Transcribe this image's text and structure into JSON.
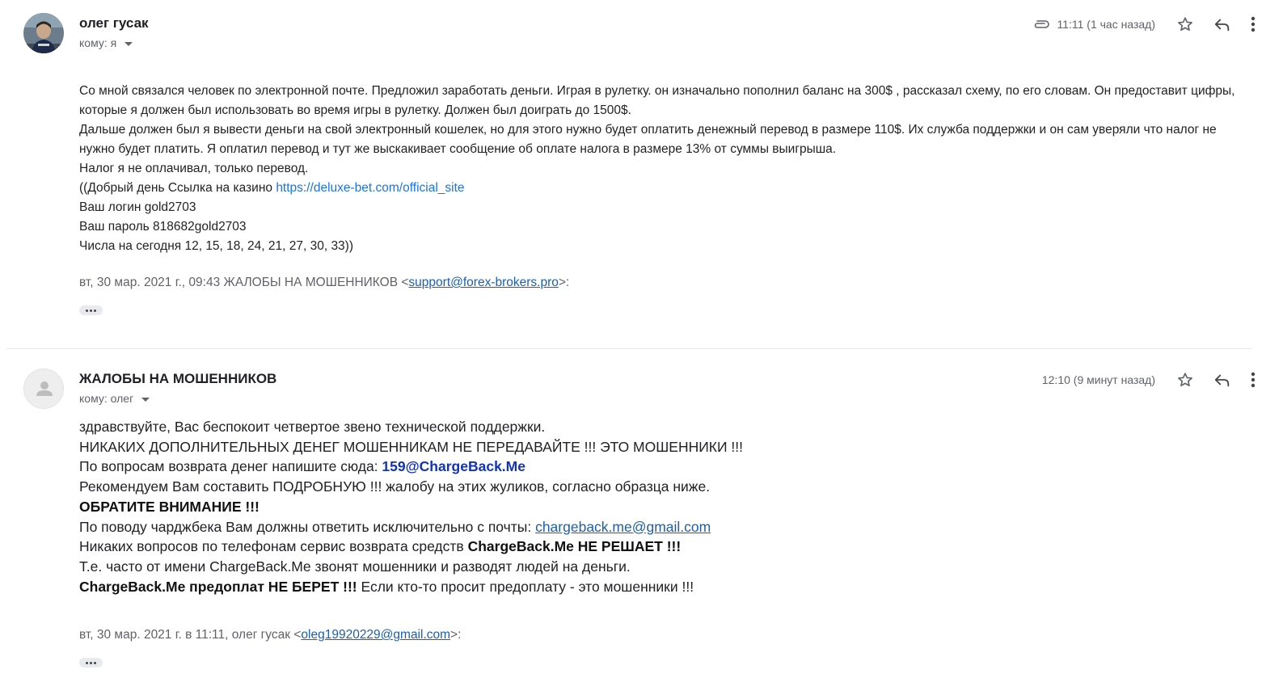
{
  "colors": {
    "link": "#1a73e8",
    "muted": "#5f6368",
    "chargeback_blue": "#1133bb"
  },
  "message1": {
    "sender": "олег гусак",
    "recipient_label": "кому: я",
    "has_attachment": true,
    "time": "11:11 (1 час назад)",
    "body": {
      "line1": "Со мной связался человек по электронной почте. Предложил заработать деньги. Играя в рулетку. он изначально пополнил баланс на 300$ , рассказал схему, по его словам. Он предоставит цифры, которые я должен был использовать во время игры в рулетку. Должен был доиграть до 1500$.",
      "line2": "Дальше должен был я вывести деньги на свой электронный кошелек, но для этого нужно будет оплатить денежный перевод в размере 110$. Их служба поддержки и он сам уверяли что налог не нужно будет платить. Я оплатил перевод и тут же выскакивает сообщение об оплате налога в размере 13% от суммы выигрыша.",
      "line3": "Налог я не оплачивал, только перевод.",
      "line4_prefix": "((Добрый день Ссылка на казино ",
      "line4_link": "https://deluxe-bet.com/official_site",
      "line5": "Ваш логин gold2703",
      "line6": "Ваш пароль 818682gold2703",
      "line7": "Числа на сегодня 12, 15, 18, 24, 21, 27, 30, 33))"
    },
    "quote_prefix": "вт, 30 мар. 2021 г., 09:43 ЖАЛОБЫ НА МОШЕННИКОВ <",
    "quote_email": "support@forex-brokers.pro",
    "quote_suffix": ">:"
  },
  "message2": {
    "sender": "ЖАЛОБЫ НА МОШЕННИКОВ",
    "recipient_label": "кому: олег",
    "time": "12:10 (9 минут назад)",
    "body": {
      "line1": "здравствуйте, Вас беспокоит четвертое звено технической поддержки.",
      "line2": "НИКАКИХ ДОПОЛНИТЕЛЬНЫХ ДЕНЕГ МОШЕННИКАМ НЕ ПЕРЕДАВАЙТЕ !!! ЭТО МОШЕННИКИ !!!",
      "line3_prefix": "По вопросам возврата денег напишите сюда: ",
      "line3_email": "159@ChargeBack.Me",
      "line4": "Рекомендуем Вам составить ПОДРОБНУЮ !!! жалобу на этих жуликов, согласно образца ниже.",
      "line5": "ОБРАТИТЕ ВНИМАНИЕ !!!",
      "line6_prefix": "По поводу чарджбека Вам должны ответить исключительно с почты: ",
      "line6_email": "chargeback.me@gmail.com",
      "line7_prefix": "Никаких вопросов по телефонам сервис возврата средств ",
      "line7_bold": "ChargeBack.Me НЕ РЕШАЕТ !!!",
      "line8": "Т.е. часто от имени ChargeBack.Me звонят мошенники и разводят людей на деньги.",
      "line9_bold": "ChargeBack.Me предоплат НЕ БЕРЕТ !!!",
      "line9_rest": " Если кто-то просит предоплату - это мошенники !!!"
    },
    "quote_prefix": "вт, 30 мар. 2021 г. в 11:11, олег гусак <",
    "quote_email": "oleg19920229@gmail.com",
    "quote_suffix": ">:"
  },
  "icons": [
    "attachment-icon",
    "star-icon",
    "reply-icon",
    "more-vert-icon",
    "avatar-placeholder-icon",
    "chevron-down-icon"
  ]
}
